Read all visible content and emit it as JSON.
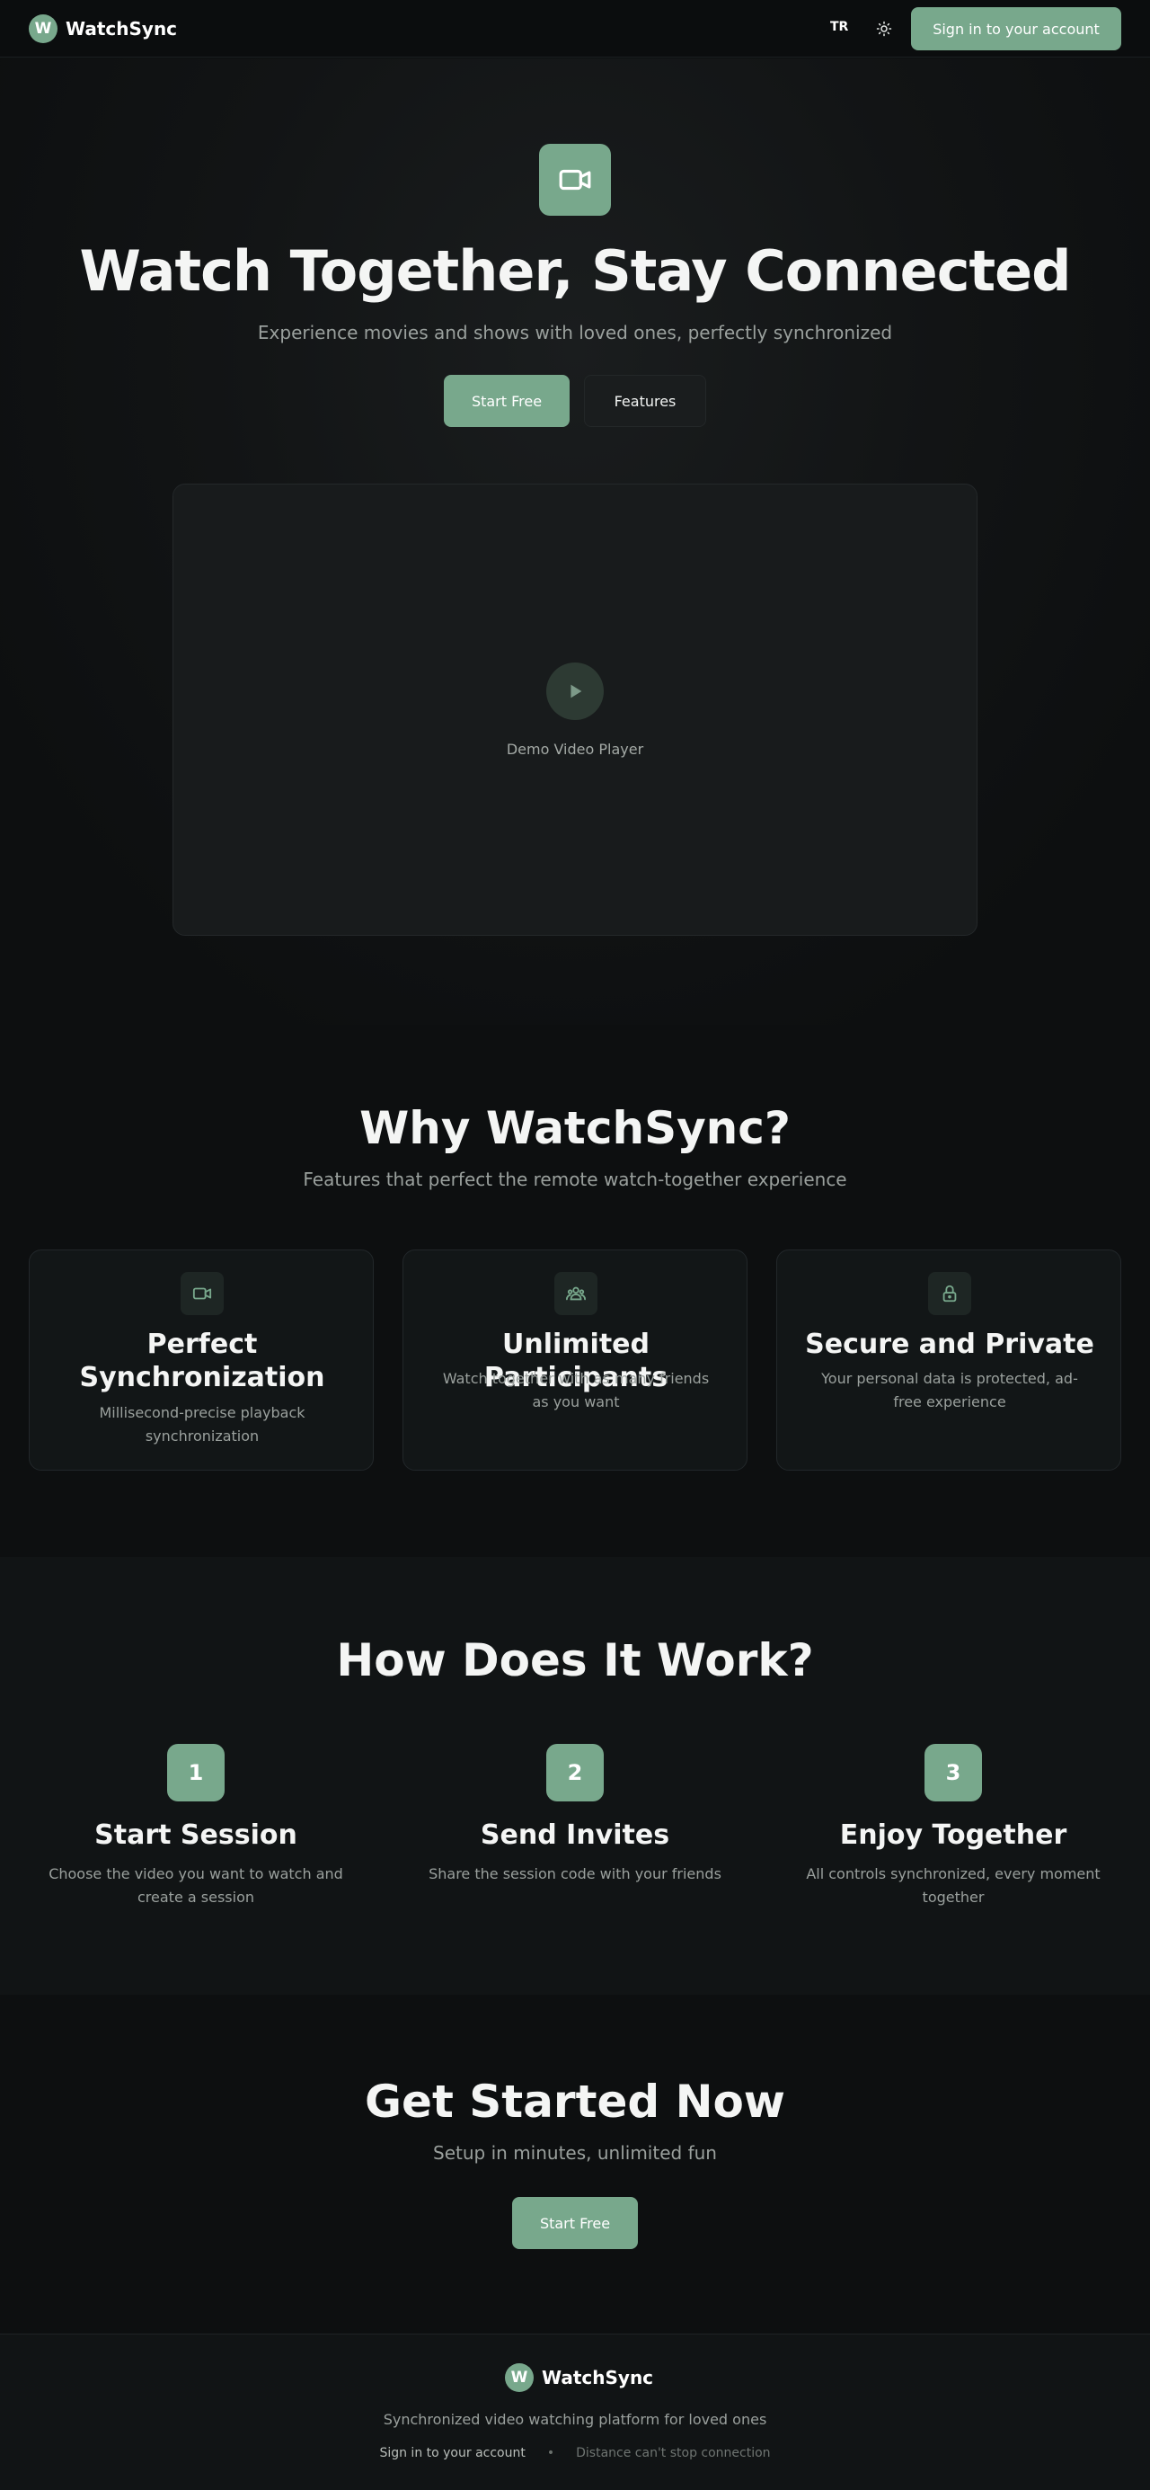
{
  "colors": {
    "accent": "#78a88c",
    "background": "#0d0f10",
    "card": "#121617"
  },
  "nav": {
    "brand_letter": "W",
    "brand_name": "WatchSync",
    "lang": "TR",
    "theme_icon": "sun-icon",
    "signin_label": "Sign in to your account"
  },
  "hero": {
    "icon": "video-camera-icon",
    "title": "Watch Together, Stay Connected",
    "subtitle": "Experience movies and shows with loved ones, perfectly synchronized",
    "primary_label": "Start Free",
    "secondary_label": "Features",
    "video_label": "Demo Video Player",
    "video_icon": "play-icon"
  },
  "why": {
    "title": "Why WatchSync?",
    "subtitle": "Features that perfect the remote watch-together experience",
    "cards": [
      {
        "icon": "video-camera-icon",
        "title": "Perfect Synchronization",
        "desc": "Millisecond-precise playback synchronization"
      },
      {
        "icon": "users-icon",
        "title": "Unlimited Participants",
        "desc": "Watch together with as many friends as you want"
      },
      {
        "icon": "lock-icon",
        "title": "Secure and Private",
        "desc": "Your personal data is protected, ad-free experience"
      }
    ]
  },
  "how": {
    "title": "How Does It Work?",
    "steps": [
      {
        "num": "1",
        "title": "Start Session",
        "desc": "Choose the video you want to watch and create a session"
      },
      {
        "num": "2",
        "title": "Send Invites",
        "desc": "Share the session code with your friends"
      },
      {
        "num": "3",
        "title": "Enjoy Together",
        "desc": "All controls synchronized, every moment together"
      }
    ]
  },
  "cta": {
    "title": "Get Started Now",
    "subtitle": "Setup in minutes, unlimited fun",
    "button_label": "Start Free"
  },
  "footer": {
    "brand_letter": "W",
    "brand_name": "WatchSync",
    "tagline": "Synchronized video watching platform for loved ones",
    "signin_link": "Sign in to your account",
    "separator": "•",
    "note": "Distance can't stop connection"
  }
}
